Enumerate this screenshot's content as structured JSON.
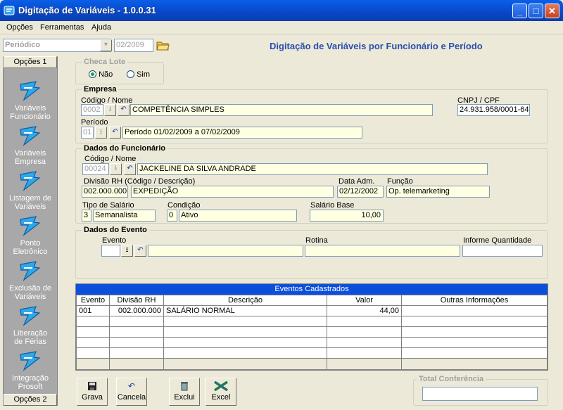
{
  "window": {
    "title": "Digitação de Variáveis - 1.0.0.31",
    "minimize": "_",
    "maximize": "□",
    "close": "✕"
  },
  "menu": [
    "Opções",
    "Ferramentas",
    "Ajuda"
  ],
  "toolbar": {
    "period_type": "Periódico",
    "period_value": "02/2009",
    "heading": "Digitação de Variáveis por Funcionário e Período"
  },
  "sidebar": {
    "header_top": "Opções 1",
    "header_bottom": "Opções 2",
    "items": [
      {
        "line1": "Variáveis",
        "line2": "Funcionário"
      },
      {
        "line1": "Variáveis",
        "line2": "Empresa"
      },
      {
        "line1": "Listagem de",
        "line2": "Variáveis"
      },
      {
        "line1": "Ponto",
        "line2": "Eletrônico"
      },
      {
        "line1": "Exclusão de",
        "line2": "Variáveis"
      },
      {
        "line1": "Liberação",
        "line2": "de Férias"
      },
      {
        "line1": "Integração",
        "line2": "Prosoft"
      }
    ]
  },
  "checa_lote": {
    "title": "Checa Lote",
    "option_no": "Não",
    "option_yes": "Sim",
    "selected": "Não"
  },
  "empresa": {
    "title": "Empresa",
    "code_name_label": "Código / Nome",
    "code": "0002",
    "name": "COMPETÊNCIA SIMPLES",
    "cnpj_label": "CNPJ / CPF",
    "cnpj": "24.931.958/0001-64",
    "period_label": "Período",
    "period_code": "01",
    "period_desc": "Período 01/02/2009 a 07/02/2009"
  },
  "funcionario": {
    "title": "Dados do Funcionário",
    "code_name_label": "Código / Nome",
    "code": "00024",
    "name": "JACKELINE DA  SILVA ANDRADE",
    "divisao_label": "Divisão RH (Código / Descrição)",
    "divisao_code": "002.000.000",
    "divisao_desc": "EXPEDIÇÃO",
    "data_adm_label": "Data Adm.",
    "data_adm": "02/12/2002",
    "funcao_label": "Função",
    "funcao": "Op. telemarketing",
    "tipo_salario_label": "Tipo de Salário",
    "tipo_salario_code": "3",
    "tipo_salario": "Semanalista",
    "condicao_label": "Condição",
    "condicao_code": "0",
    "condicao": "Ativo",
    "salario_base_label": "Salário Base",
    "salario_base": "10,00"
  },
  "evento": {
    "title": "Dados do Evento",
    "evento_label": "Evento",
    "rotina_label": "Rotina",
    "informe_label": "Informe Quantidade"
  },
  "grid": {
    "title": "Eventos Cadastrados",
    "columns": [
      "Evento",
      "Divisão RH",
      "Descrição",
      "Valor",
      "Outras Informações"
    ],
    "rows": [
      [
        "001",
        "002.000.000",
        "SALÁRIO NORMAL",
        "44,00",
        ""
      ]
    ]
  },
  "actions": {
    "grava": "Grava",
    "cancela": "Cancela",
    "exclui": "Exclui",
    "excel": "Excel"
  },
  "total": {
    "title": "Total Conferência",
    "value": ""
  }
}
